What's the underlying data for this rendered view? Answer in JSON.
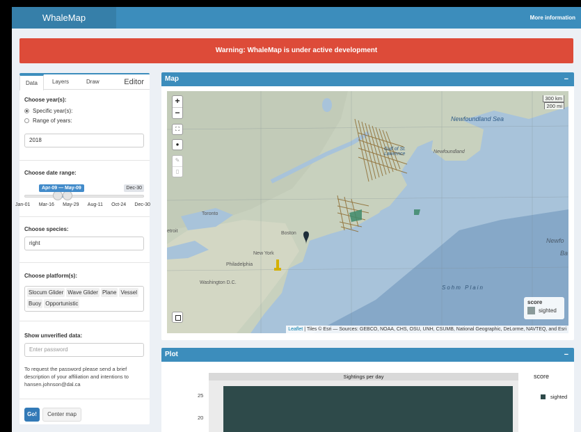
{
  "header": {
    "app_title": "WhaleMap",
    "more_info": "More information"
  },
  "warning": "Warning: WhaleMap is under active development",
  "sidebar": {
    "tabs": [
      "Data",
      "Layers",
      "Draw"
    ],
    "editor_label": "Editor",
    "year": {
      "label": "Choose year(s):",
      "options": [
        "Specific year(s):",
        "Range of years:"
      ],
      "selected": "Specific year(s):",
      "value": "2018"
    },
    "date_range": {
      "label": "Choose date range:",
      "selected": "Apr-09 — May-09",
      "max": "Dec-30",
      "ticks": [
        "Jan-01",
        "Mar-16",
        "May-29",
        "Aug-11",
        "Oct-24",
        "Dec-30"
      ]
    },
    "species": {
      "label": "Choose species:",
      "value": "right"
    },
    "platforms": {
      "label": "Choose platform(s):",
      "tags": [
        "Slocum Glider",
        "Wave Glider",
        "Plane",
        "Vessel",
        "Buoy",
        "Opportunistic"
      ]
    },
    "unverified": {
      "label": "Show unverified data:",
      "placeholder": "Enter password",
      "help": "To request the password please send a brief description of your affiliation and intentions to hansen.johnson@dal.ca"
    },
    "buttons": {
      "go": "Go!",
      "center": "Center map"
    }
  },
  "map_box": {
    "title": "Map",
    "collapse": "−",
    "zoom_in": "+",
    "zoom_out": "−",
    "scale_km": "300 km",
    "scale_mi": "200 mi",
    "legend": {
      "title": "score",
      "item": "sighted"
    },
    "attribution_link": "Leaflet",
    "attribution_text": " | Tiles © Esri — Sources: GEBCO, NOAA, CHS, OSU, UNH, CSUMB, National Geographic, DeLorme, NAVTEQ, and Esri",
    "labels": {
      "newfoundland_sea": "Newfoundland Sea",
      "gulf": "Gulf of St. Lawrence",
      "newfoundland": "Newfoundland",
      "toronto": "Toronto",
      "boston": "Boston",
      "new_york": "New York",
      "philadelphia": "Philadelphia",
      "washington": "Washington D.C.",
      "sohm_plain": "Sohm Plain",
      "detroit": "etroit",
      "newfo": "Newfo",
      "ba": "Ba"
    }
  },
  "plot_box": {
    "title": "Plot",
    "collapse": "−",
    "chart_data": {
      "type": "bar",
      "title": "Sightings per day",
      "y_ticks": [
        "25",
        "20"
      ],
      "legend_title": "score",
      "series": [
        {
          "name": "sighted"
        }
      ]
    }
  }
}
